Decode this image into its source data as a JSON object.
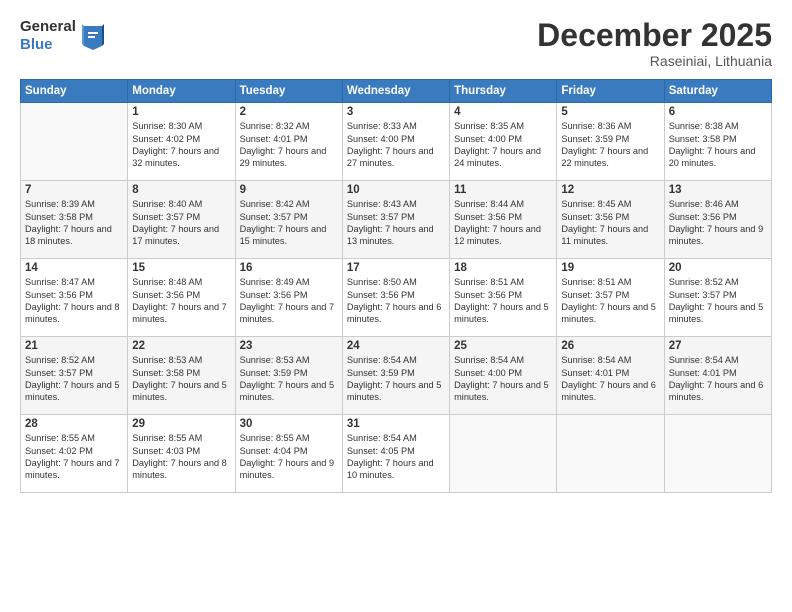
{
  "header": {
    "logo_general": "General",
    "logo_blue": "Blue",
    "month": "December 2025",
    "location": "Raseiniai, Lithuania"
  },
  "weekdays": [
    "Sunday",
    "Monday",
    "Tuesday",
    "Wednesday",
    "Thursday",
    "Friday",
    "Saturday"
  ],
  "weeks": [
    [
      {
        "day": "",
        "info": ""
      },
      {
        "day": "1",
        "info": "Sunrise: 8:30 AM\nSunset: 4:02 PM\nDaylight: 7 hours\nand 32 minutes."
      },
      {
        "day": "2",
        "info": "Sunrise: 8:32 AM\nSunset: 4:01 PM\nDaylight: 7 hours\nand 29 minutes."
      },
      {
        "day": "3",
        "info": "Sunrise: 8:33 AM\nSunset: 4:00 PM\nDaylight: 7 hours\nand 27 minutes."
      },
      {
        "day": "4",
        "info": "Sunrise: 8:35 AM\nSunset: 4:00 PM\nDaylight: 7 hours\nand 24 minutes."
      },
      {
        "day": "5",
        "info": "Sunrise: 8:36 AM\nSunset: 3:59 PM\nDaylight: 7 hours\nand 22 minutes."
      },
      {
        "day": "6",
        "info": "Sunrise: 8:38 AM\nSunset: 3:58 PM\nDaylight: 7 hours\nand 20 minutes."
      }
    ],
    [
      {
        "day": "7",
        "info": "Sunrise: 8:39 AM\nSunset: 3:58 PM\nDaylight: 7 hours\nand 18 minutes."
      },
      {
        "day": "8",
        "info": "Sunrise: 8:40 AM\nSunset: 3:57 PM\nDaylight: 7 hours\nand 17 minutes."
      },
      {
        "day": "9",
        "info": "Sunrise: 8:42 AM\nSunset: 3:57 PM\nDaylight: 7 hours\nand 15 minutes."
      },
      {
        "day": "10",
        "info": "Sunrise: 8:43 AM\nSunset: 3:57 PM\nDaylight: 7 hours\nand 13 minutes."
      },
      {
        "day": "11",
        "info": "Sunrise: 8:44 AM\nSunset: 3:56 PM\nDaylight: 7 hours\nand 12 minutes."
      },
      {
        "day": "12",
        "info": "Sunrise: 8:45 AM\nSunset: 3:56 PM\nDaylight: 7 hours\nand 11 minutes."
      },
      {
        "day": "13",
        "info": "Sunrise: 8:46 AM\nSunset: 3:56 PM\nDaylight: 7 hours\nand 9 minutes."
      }
    ],
    [
      {
        "day": "14",
        "info": "Sunrise: 8:47 AM\nSunset: 3:56 PM\nDaylight: 7 hours\nand 8 minutes."
      },
      {
        "day": "15",
        "info": "Sunrise: 8:48 AM\nSunset: 3:56 PM\nDaylight: 7 hours\nand 7 minutes."
      },
      {
        "day": "16",
        "info": "Sunrise: 8:49 AM\nSunset: 3:56 PM\nDaylight: 7 hours\nand 7 minutes."
      },
      {
        "day": "17",
        "info": "Sunrise: 8:50 AM\nSunset: 3:56 PM\nDaylight: 7 hours\nand 6 minutes."
      },
      {
        "day": "18",
        "info": "Sunrise: 8:51 AM\nSunset: 3:56 PM\nDaylight: 7 hours\nand 5 minutes."
      },
      {
        "day": "19",
        "info": "Sunrise: 8:51 AM\nSunset: 3:57 PM\nDaylight: 7 hours\nand 5 minutes."
      },
      {
        "day": "20",
        "info": "Sunrise: 8:52 AM\nSunset: 3:57 PM\nDaylight: 7 hours\nand 5 minutes."
      }
    ],
    [
      {
        "day": "21",
        "info": "Sunrise: 8:52 AM\nSunset: 3:57 PM\nDaylight: 7 hours\nand 5 minutes."
      },
      {
        "day": "22",
        "info": "Sunrise: 8:53 AM\nSunset: 3:58 PM\nDaylight: 7 hours\nand 5 minutes."
      },
      {
        "day": "23",
        "info": "Sunrise: 8:53 AM\nSunset: 3:59 PM\nDaylight: 7 hours\nand 5 minutes."
      },
      {
        "day": "24",
        "info": "Sunrise: 8:54 AM\nSunset: 3:59 PM\nDaylight: 7 hours\nand 5 minutes."
      },
      {
        "day": "25",
        "info": "Sunrise: 8:54 AM\nSunset: 4:00 PM\nDaylight: 7 hours\nand 5 minutes."
      },
      {
        "day": "26",
        "info": "Sunrise: 8:54 AM\nSunset: 4:01 PM\nDaylight: 7 hours\nand 6 minutes."
      },
      {
        "day": "27",
        "info": "Sunrise: 8:54 AM\nSunset: 4:01 PM\nDaylight: 7 hours\nand 6 minutes."
      }
    ],
    [
      {
        "day": "28",
        "info": "Sunrise: 8:55 AM\nSunset: 4:02 PM\nDaylight: 7 hours\nand 7 minutes."
      },
      {
        "day": "29",
        "info": "Sunrise: 8:55 AM\nSunset: 4:03 PM\nDaylight: 7 hours\nand 8 minutes."
      },
      {
        "day": "30",
        "info": "Sunrise: 8:55 AM\nSunset: 4:04 PM\nDaylight: 7 hours\nand 9 minutes."
      },
      {
        "day": "31",
        "info": "Sunrise: 8:54 AM\nSunset: 4:05 PM\nDaylight: 7 hours\nand 10 minutes."
      },
      {
        "day": "",
        "info": ""
      },
      {
        "day": "",
        "info": ""
      },
      {
        "day": "",
        "info": ""
      }
    ]
  ]
}
